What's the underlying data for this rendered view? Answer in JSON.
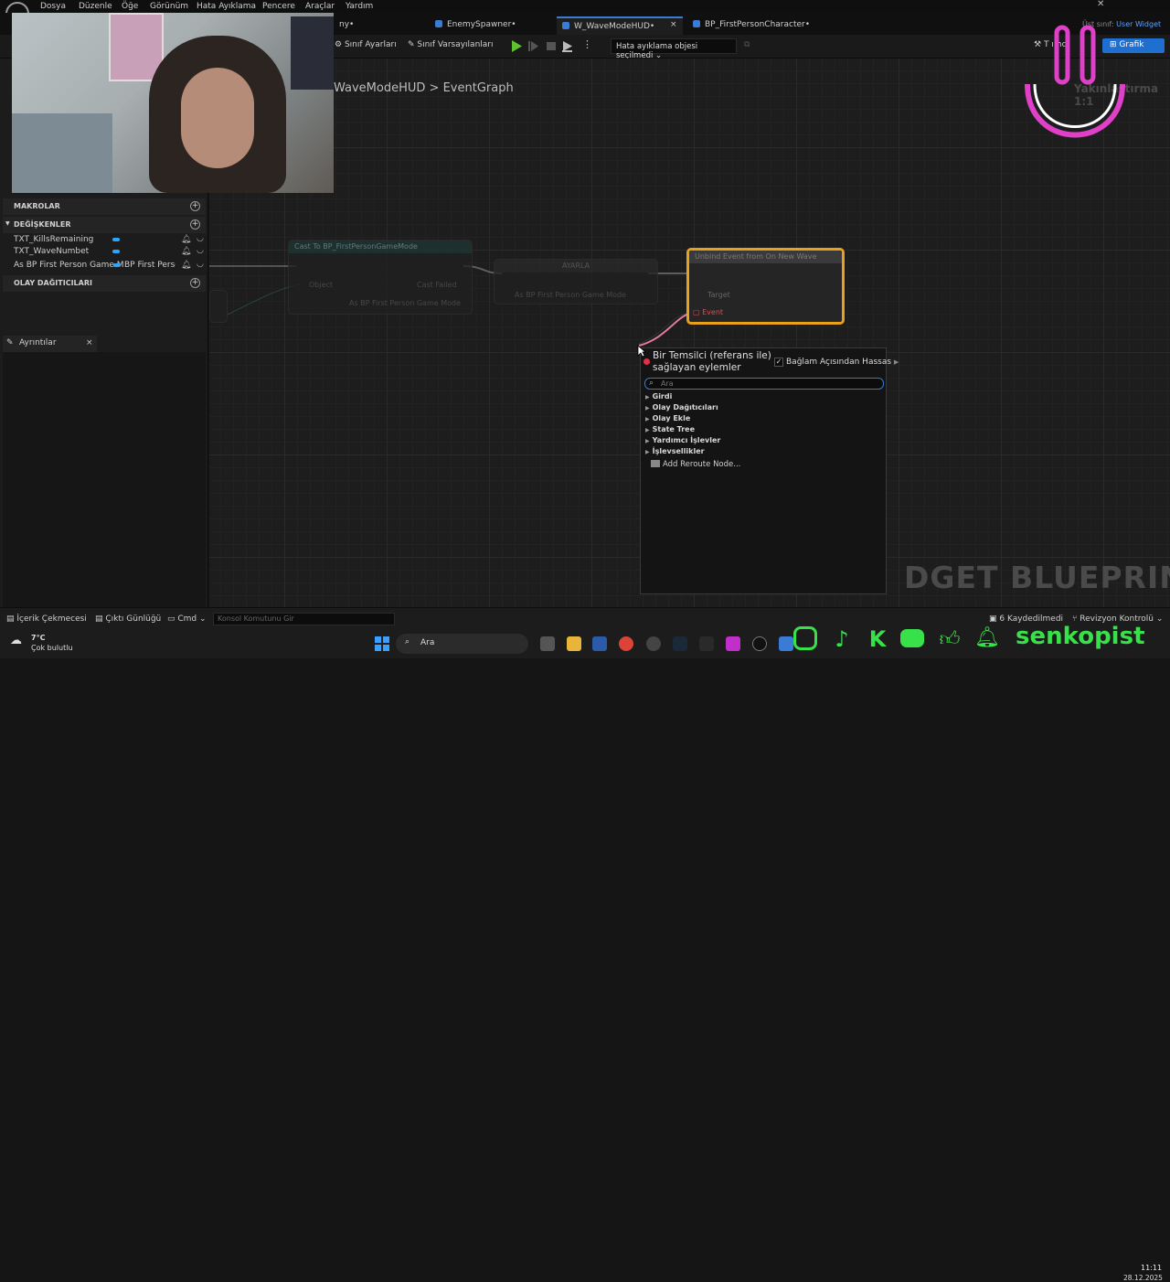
{
  "menu": [
    "Dosya",
    "Düzenle",
    "Öğe",
    "Görünüm",
    "Hata Ayıklama",
    "Pencere",
    "Araçlar",
    "Yardım"
  ],
  "tabs": {
    "partial": "ny•",
    "enemy_spawner": "EnemySpawner•",
    "wave_hud": "W_WaveModeHUD•",
    "character": "BP_FirstPersonCharacter•",
    "close_glyph": "×"
  },
  "parent_class": {
    "label": "Üst sınıf:",
    "value": "User Widget"
  },
  "window_controls": "– ❐ ✕",
  "toolbar": {
    "class_settings": "Sınıf Ayarları",
    "class_defaults": "Sınıf Varsayılanları",
    "debug_object": "Hata ayıklama objesi seçilmedi",
    "partial_button": "T    ımcı",
    "graph_button": "Grafik"
  },
  "left_panel": {
    "macros": "MAKROLAR",
    "variables": "DEĞİŞKENLER",
    "event_dispatchers": "OLAY DAĞITICILARI",
    "vars": [
      {
        "name": "TXT_KillsRemaining",
        "type": ""
      },
      {
        "name": "TXT_WaveNumbet",
        "type": ""
      },
      {
        "name": "As BP First Person Game M",
        "type": "BP First Perso"
      }
    ],
    "details_tab": "Ayrıntılar",
    "details_close": "×"
  },
  "graph": {
    "breadcrumb_root": "WaveModeHUD",
    "breadcrumb_sep": ">",
    "breadcrumb_graph": "EventGraph",
    "zoom": "Yakınlaştırma 1:1",
    "watermark": "DGET BLUEPRINT'I",
    "node_cast": {
      "title": "Cast To BP_FirstPersonGameMode",
      "object": "Object",
      "cast_failed": "Cast Failed",
      "as": "As BP First Person Game Mode"
    },
    "node_set": {
      "title": "AYARLA",
      "pin": "As BP First Person Game Mode"
    },
    "node_unbind": {
      "title": "Unbind Event from On New Wave",
      "target": "Target",
      "event": "Event"
    }
  },
  "action_menu": {
    "title": "Bir Temsilci (referans ile) sağlayan eylemler",
    "context_sensitive": "Bağlam Açısından Hassas",
    "check_glyph": "✓",
    "search_placeholder": "Ara",
    "categories": [
      "Girdi",
      "Olay Dağıtıcıları",
      "Olay Ekle",
      "State Tree",
      "Yardımcı İşlevler",
      "İşlevsellikler"
    ],
    "reroute": "Add Reroute Node..."
  },
  "bottom_bar": {
    "content_drawer": "İçerik Çekmecesi",
    "output_log": "Çıktı Günlüğü",
    "cmd": "Cmd",
    "console_placeholder": "Konsol Komutunu Gir",
    "saved": "6 Kaydedilmedi",
    "revision": "Revizyon Kontrolü"
  },
  "taskbar": {
    "weather_temp": "7°C",
    "weather_desc": "Çok bulutlu",
    "search": "Ara",
    "time": "11:11",
    "date": "28.12.2025"
  },
  "overlay": {
    "channel": "senkopist"
  },
  "colors": {
    "accent_blue": "#1f6fd1",
    "selection_orange": "#e7a11a",
    "var_pill": "#2aa6ff",
    "brand_green": "#38e04a",
    "pink_logo": "#e040c8"
  }
}
